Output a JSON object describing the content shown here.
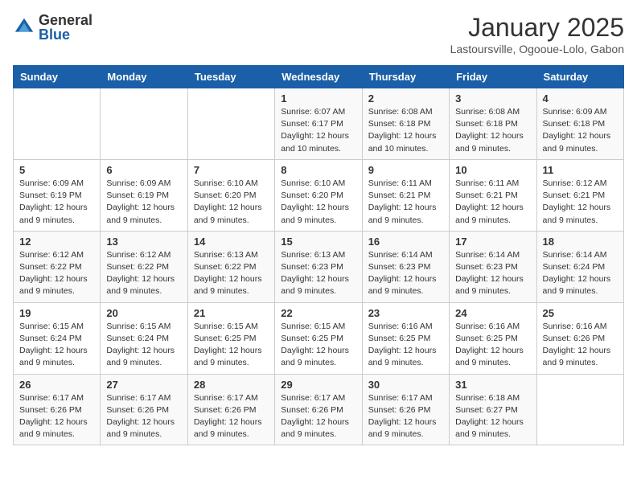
{
  "header": {
    "logo_general": "General",
    "logo_blue": "Blue",
    "month_title": "January 2025",
    "location": "Lastoursville, Ogooue-Lolo, Gabon"
  },
  "days_of_week": [
    "Sunday",
    "Monday",
    "Tuesday",
    "Wednesday",
    "Thursday",
    "Friday",
    "Saturday"
  ],
  "weeks": [
    [
      {
        "day": "",
        "info": ""
      },
      {
        "day": "",
        "info": ""
      },
      {
        "day": "",
        "info": ""
      },
      {
        "day": "1",
        "info": "Sunrise: 6:07 AM\nSunset: 6:17 PM\nDaylight: 12 hours\nand 10 minutes."
      },
      {
        "day": "2",
        "info": "Sunrise: 6:08 AM\nSunset: 6:18 PM\nDaylight: 12 hours\nand 10 minutes."
      },
      {
        "day": "3",
        "info": "Sunrise: 6:08 AM\nSunset: 6:18 PM\nDaylight: 12 hours\nand 9 minutes."
      },
      {
        "day": "4",
        "info": "Sunrise: 6:09 AM\nSunset: 6:18 PM\nDaylight: 12 hours\nand 9 minutes."
      }
    ],
    [
      {
        "day": "5",
        "info": "Sunrise: 6:09 AM\nSunset: 6:19 PM\nDaylight: 12 hours\nand 9 minutes."
      },
      {
        "day": "6",
        "info": "Sunrise: 6:09 AM\nSunset: 6:19 PM\nDaylight: 12 hours\nand 9 minutes."
      },
      {
        "day": "7",
        "info": "Sunrise: 6:10 AM\nSunset: 6:20 PM\nDaylight: 12 hours\nand 9 minutes."
      },
      {
        "day": "8",
        "info": "Sunrise: 6:10 AM\nSunset: 6:20 PM\nDaylight: 12 hours\nand 9 minutes."
      },
      {
        "day": "9",
        "info": "Sunrise: 6:11 AM\nSunset: 6:21 PM\nDaylight: 12 hours\nand 9 minutes."
      },
      {
        "day": "10",
        "info": "Sunrise: 6:11 AM\nSunset: 6:21 PM\nDaylight: 12 hours\nand 9 minutes."
      },
      {
        "day": "11",
        "info": "Sunrise: 6:12 AM\nSunset: 6:21 PM\nDaylight: 12 hours\nand 9 minutes."
      }
    ],
    [
      {
        "day": "12",
        "info": "Sunrise: 6:12 AM\nSunset: 6:22 PM\nDaylight: 12 hours\nand 9 minutes."
      },
      {
        "day": "13",
        "info": "Sunrise: 6:12 AM\nSunset: 6:22 PM\nDaylight: 12 hours\nand 9 minutes."
      },
      {
        "day": "14",
        "info": "Sunrise: 6:13 AM\nSunset: 6:22 PM\nDaylight: 12 hours\nand 9 minutes."
      },
      {
        "day": "15",
        "info": "Sunrise: 6:13 AM\nSunset: 6:23 PM\nDaylight: 12 hours\nand 9 minutes."
      },
      {
        "day": "16",
        "info": "Sunrise: 6:14 AM\nSunset: 6:23 PM\nDaylight: 12 hours\nand 9 minutes."
      },
      {
        "day": "17",
        "info": "Sunrise: 6:14 AM\nSunset: 6:23 PM\nDaylight: 12 hours\nand 9 minutes."
      },
      {
        "day": "18",
        "info": "Sunrise: 6:14 AM\nSunset: 6:24 PM\nDaylight: 12 hours\nand 9 minutes."
      }
    ],
    [
      {
        "day": "19",
        "info": "Sunrise: 6:15 AM\nSunset: 6:24 PM\nDaylight: 12 hours\nand 9 minutes."
      },
      {
        "day": "20",
        "info": "Sunrise: 6:15 AM\nSunset: 6:24 PM\nDaylight: 12 hours\nand 9 minutes."
      },
      {
        "day": "21",
        "info": "Sunrise: 6:15 AM\nSunset: 6:25 PM\nDaylight: 12 hours\nand 9 minutes."
      },
      {
        "day": "22",
        "info": "Sunrise: 6:15 AM\nSunset: 6:25 PM\nDaylight: 12 hours\nand 9 minutes."
      },
      {
        "day": "23",
        "info": "Sunrise: 6:16 AM\nSunset: 6:25 PM\nDaylight: 12 hours\nand 9 minutes."
      },
      {
        "day": "24",
        "info": "Sunrise: 6:16 AM\nSunset: 6:25 PM\nDaylight: 12 hours\nand 9 minutes."
      },
      {
        "day": "25",
        "info": "Sunrise: 6:16 AM\nSunset: 6:26 PM\nDaylight: 12 hours\nand 9 minutes."
      }
    ],
    [
      {
        "day": "26",
        "info": "Sunrise: 6:17 AM\nSunset: 6:26 PM\nDaylight: 12 hours\nand 9 minutes."
      },
      {
        "day": "27",
        "info": "Sunrise: 6:17 AM\nSunset: 6:26 PM\nDaylight: 12 hours\nand 9 minutes."
      },
      {
        "day": "28",
        "info": "Sunrise: 6:17 AM\nSunset: 6:26 PM\nDaylight: 12 hours\nand 9 minutes."
      },
      {
        "day": "29",
        "info": "Sunrise: 6:17 AM\nSunset: 6:26 PM\nDaylight: 12 hours\nand 9 minutes."
      },
      {
        "day": "30",
        "info": "Sunrise: 6:17 AM\nSunset: 6:26 PM\nDaylight: 12 hours\nand 9 minutes."
      },
      {
        "day": "31",
        "info": "Sunrise: 6:18 AM\nSunset: 6:27 PM\nDaylight: 12 hours\nand 9 minutes."
      },
      {
        "day": "",
        "info": ""
      }
    ]
  ]
}
